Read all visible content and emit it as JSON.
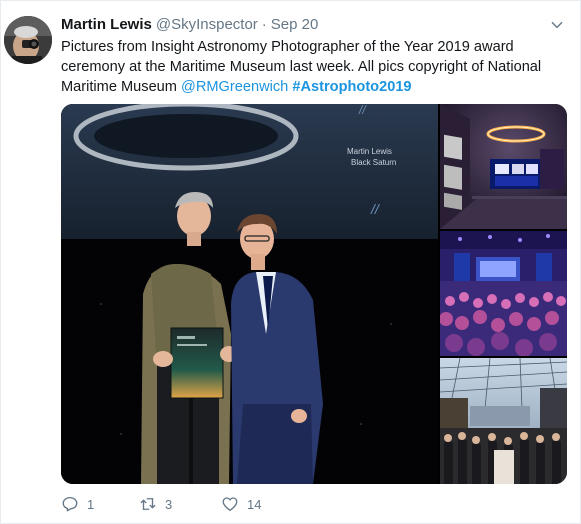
{
  "tweet": {
    "author_name": "Martin Lewis",
    "author_handle": "@SkyInspector",
    "separator": "·",
    "timestamp": "Sep 20",
    "text_plain": "Pictures from Insight Astronomy Photographer of the Year 2019 award ceremony at the Maritime Museum last week. All pics copyright of National Maritime Museum ",
    "text_mention": "@RMGreenwich",
    "text_hashtag": "#Astrophoto2019",
    "media": {
      "main_screen_caption_line1": "Martin Lewis",
      "main_screen_caption_line2": "Black Saturn"
    },
    "actions": {
      "reply_count": "1",
      "retweet_count": "3",
      "like_count": "14"
    }
  },
  "colors": {
    "link": "#1b95e0",
    "muted": "#657786",
    "text": "#14171a",
    "border": "#e6ecf0"
  },
  "icons": {
    "reply": "reply-icon",
    "retweet": "retweet-icon",
    "like": "heart-icon",
    "more": "chevron-down-icon"
  }
}
